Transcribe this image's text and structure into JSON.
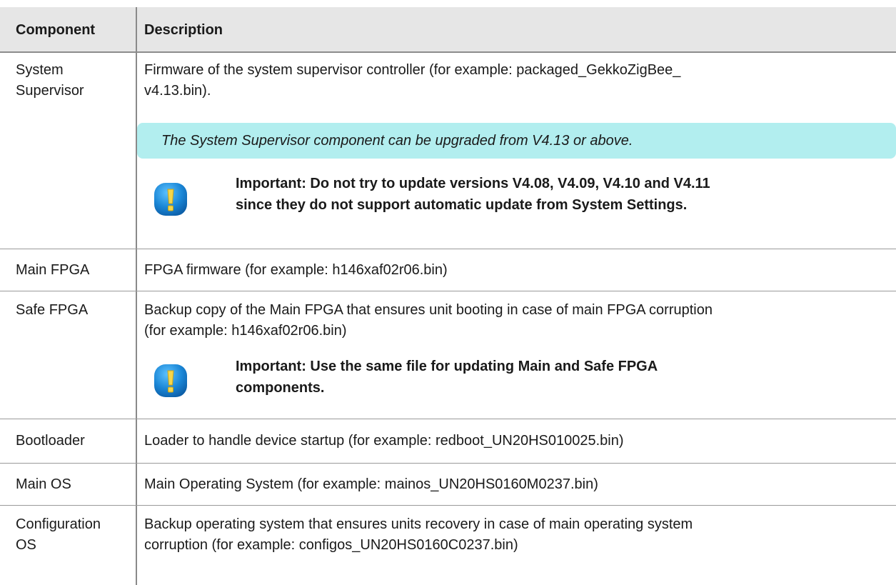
{
  "header": {
    "component": "Component",
    "description": "Description"
  },
  "rows": [
    {
      "component_line1": "System",
      "component_line2": "Supervisor",
      "description_line1": "Firmware of the system supervisor controller (for example: packaged_GekkoZigBee_",
      "description_line2": "v4.13.bin).",
      "note": "The System Supervisor component can be upgraded from V4.13 or above.",
      "important_line1": "Important: Do not try to update versions V4.08, V4.09, V4.10 and V4.11",
      "important_line2": "since they do not support automatic update from System Settings."
    },
    {
      "component": "Main FPGA",
      "description": "FPGA firmware (for example: h146xaf02r06.bin)"
    },
    {
      "component": "Safe FPGA",
      "description_line1": "Backup copy of the Main FPGA that ensures unit booting in case of main FPGA corruption",
      "description_line2": "(for example: h146xaf02r06.bin)",
      "important_line1": "Important: Use the same file for updating Main and Safe FPGA",
      "important_line2": "components."
    },
    {
      "component": "Bootloader",
      "description": "Loader to handle device startup (for example: redboot_UN20HS010025.bin)"
    },
    {
      "component": "Main OS",
      "description": "Main Operating System (for example: mainos_UN20HS0160M0237.bin)"
    },
    {
      "component_line1": "Configuration",
      "component_line2": "OS",
      "description_line1": "Backup operating system that ensures units recovery in case of main operating system",
      "description_line2": "corruption (for example: configos_UN20HS0160C0237.bin)"
    }
  ],
  "colors": {
    "header_bg": "#e6e6e6",
    "note_bg": "#b2eeef",
    "icon_blue": "#1a86d6"
  },
  "icons": {
    "important": "exclamation-icon"
  }
}
